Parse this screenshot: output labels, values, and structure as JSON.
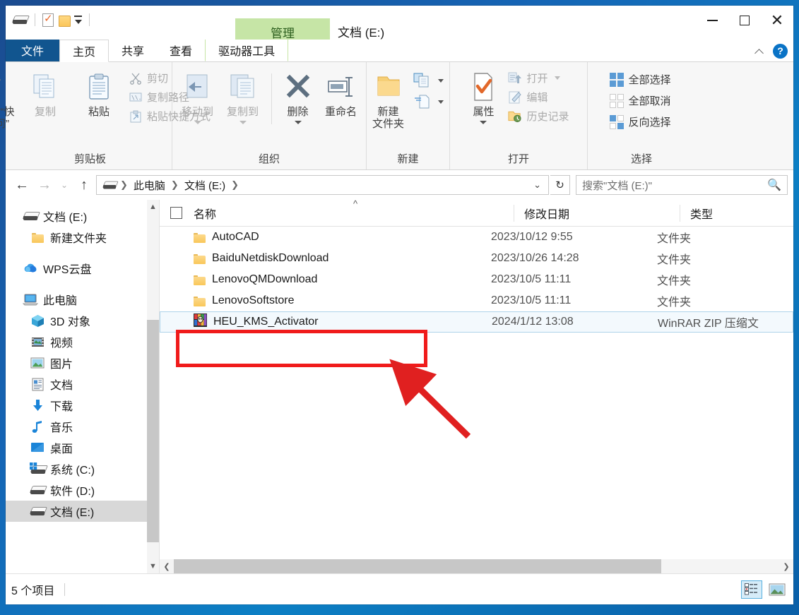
{
  "window": {
    "title": "文档 (E:)",
    "contextual_tab_header": "管理",
    "controls": {
      "minimize": "minimize-icon",
      "maximize": "maximize-icon",
      "close": "close-icon"
    }
  },
  "quick_access": {
    "items": [
      {
        "name": "drive-icon",
        "label": "文档 (E:)"
      },
      {
        "name": "properties-icon",
        "label": "属性"
      },
      {
        "name": "new-folder-icon",
        "label": "新建文件夹"
      },
      {
        "name": "customize-caret-icon",
        "label": "自定义快速访问工具栏"
      }
    ]
  },
  "tabs": [
    {
      "id": "file",
      "label": "文件",
      "state": "file"
    },
    {
      "id": "home",
      "label": "主页",
      "state": "active"
    },
    {
      "id": "share",
      "label": "共享",
      "state": "normal"
    },
    {
      "id": "view",
      "label": "查看",
      "state": "normal"
    },
    {
      "id": "drive-tools",
      "label": "驱动器工具",
      "state": "contextual"
    }
  ],
  "ribbon_right": {
    "collapse": "chevron-up-icon",
    "help": "?"
  },
  "ribbon": {
    "groups": [
      {
        "id": "clipboard",
        "label": "剪贴板",
        "big_buttons": [
          {
            "id": "pin-to-quick-access",
            "label": "固定到“快\n速访问”",
            "icon": "pin-icon",
            "dim": false
          },
          {
            "id": "copy",
            "label": "复制",
            "icon": "copy-icon",
            "dim": true
          },
          {
            "id": "paste",
            "label": "粘贴",
            "icon": "paste-icon",
            "dim": false
          }
        ],
        "small_buttons": [
          {
            "id": "cut",
            "label": "剪切",
            "icon": "scissors-icon",
            "dim": true
          },
          {
            "id": "copy-path",
            "label": "复制路径",
            "icon": "copy-path-icon",
            "dim": true
          },
          {
            "id": "paste-shortcut",
            "label": "粘贴快捷方式",
            "icon": "paste-shortcut-icon",
            "dim": true
          }
        ]
      },
      {
        "id": "organize",
        "label": "组织",
        "big_buttons": [
          {
            "id": "move-to",
            "label": "移动到",
            "icon": "move-to-icon",
            "dim": true,
            "caret": true
          },
          {
            "id": "copy-to",
            "label": "复制到",
            "icon": "copy-to-icon",
            "dim": true,
            "caret": true
          },
          {
            "id": "delete",
            "label": "删除",
            "icon": "delete-x-icon",
            "dim": false,
            "caret": true
          },
          {
            "id": "rename",
            "label": "重命名",
            "icon": "rename-icon",
            "dim": false,
            "caret": false
          }
        ]
      },
      {
        "id": "new",
        "label": "新建",
        "big_buttons": [
          {
            "id": "new-folder",
            "label": "新建\n文件夹",
            "icon": "new-folder-icon",
            "dim": false
          }
        ],
        "small_buttons": [
          {
            "id": "new-item",
            "label": "",
            "icon": "new-item-icon",
            "dim": false,
            "caret": true
          },
          {
            "id": "easy-access",
            "label": "",
            "icon": "easy-access-icon",
            "dim": false,
            "caret": true
          }
        ]
      },
      {
        "id": "open",
        "label": "打开",
        "big_buttons": [
          {
            "id": "properties",
            "label": "属性",
            "icon": "properties-icon",
            "dim": false,
            "caret": true
          }
        ],
        "small_buttons": [
          {
            "id": "open",
            "label": "打开",
            "icon": "open-icon",
            "dim": true,
            "caret": true
          },
          {
            "id": "edit",
            "label": "编辑",
            "icon": "edit-icon",
            "dim": true
          },
          {
            "id": "history",
            "label": "历史记录",
            "icon": "history-icon",
            "dim": true
          }
        ]
      },
      {
        "id": "select",
        "label": "选择",
        "small_buttons": [
          {
            "id": "select-all",
            "label": "全部选择",
            "icon": "select-all-icon",
            "dim": false
          },
          {
            "id": "select-none",
            "label": "全部取消",
            "icon": "select-none-icon",
            "dim": false
          },
          {
            "id": "invert-selection",
            "label": "反向选择",
            "icon": "invert-selection-icon",
            "dim": false
          }
        ]
      }
    ]
  },
  "navbar": {
    "back": "←",
    "forward": "→",
    "recent": "⌄",
    "up": "↑",
    "breadcrumbs": [
      {
        "label": "此电脑"
      },
      {
        "label": "文档 (E:)"
      }
    ],
    "refresh": "↻",
    "search_placeholder": "搜索\"文档 (E:)\""
  },
  "sidebar": {
    "items": [
      {
        "id": "doc-e-quick",
        "label": "文档 (E:)",
        "icon": "drive-icon",
        "indent": 1,
        "selected": false
      },
      {
        "id": "new-folder-quick",
        "label": "新建文件夹",
        "icon": "folder-icon",
        "indent": 1,
        "selected": false
      },
      {
        "id": "spacer-1",
        "label": "",
        "icon": "",
        "spacer": true
      },
      {
        "id": "wps-cloud",
        "label": "WPS云盘",
        "icon": "cloud-icon",
        "indent": 0,
        "selected": false
      },
      {
        "id": "spacer-2",
        "label": "",
        "icon": "",
        "spacer": true
      },
      {
        "id": "this-pc",
        "label": "此电脑",
        "icon": "computer-icon",
        "indent": 0,
        "selected": false
      },
      {
        "id": "3d-objects",
        "label": "3D 对象",
        "icon": "3d-objects-icon",
        "indent": 1,
        "selected": false
      },
      {
        "id": "videos",
        "label": "视频",
        "icon": "videos-icon",
        "indent": 1,
        "selected": false
      },
      {
        "id": "pictures",
        "label": "图片",
        "icon": "pictures-icon",
        "indent": 1,
        "selected": false
      },
      {
        "id": "documents",
        "label": "文档",
        "icon": "documents-icon",
        "indent": 1,
        "selected": false
      },
      {
        "id": "downloads",
        "label": "下载",
        "icon": "downloads-icon",
        "indent": 1,
        "selected": false
      },
      {
        "id": "music",
        "label": "音乐",
        "icon": "music-icon",
        "indent": 1,
        "selected": false
      },
      {
        "id": "desktop",
        "label": "桌面",
        "icon": "desktop-icon",
        "indent": 1,
        "selected": false
      },
      {
        "id": "drive-c",
        "label": "系统 (C:)",
        "icon": "windows-drive-icon",
        "indent": 1,
        "selected": false
      },
      {
        "id": "drive-d",
        "label": "软件 (D:)",
        "icon": "drive-icon",
        "indent": 1,
        "selected": false
      },
      {
        "id": "drive-e",
        "label": "文档 (E:)",
        "icon": "drive-icon",
        "indent": 1,
        "selected": true
      }
    ]
  },
  "file_list": {
    "columns": [
      {
        "id": "name",
        "label": "名称",
        "sorted": "asc"
      },
      {
        "id": "date",
        "label": "修改日期"
      },
      {
        "id": "type",
        "label": "类型"
      }
    ],
    "rows": [
      {
        "name": "AutoCAD",
        "date": "2023/10/12 9:55",
        "type": "文件夹",
        "icon": "folder-icon",
        "selected": false
      },
      {
        "name": "BaiduNetdiskDownload",
        "date": "2023/10/26 14:28",
        "type": "文件夹",
        "icon": "folder-icon",
        "selected": false
      },
      {
        "name": "LenovoQMDownload",
        "date": "2023/10/5 11:11",
        "type": "文件夹",
        "icon": "folder-icon",
        "selected": false
      },
      {
        "name": "LenovoSoftstore",
        "date": "2023/10/5 11:11",
        "type": "文件夹",
        "icon": "folder-icon",
        "selected": false
      },
      {
        "name": "HEU_KMS_Activator",
        "date": "2024/1/12 13:08",
        "type": "WinRAR ZIP 压缩文",
        "icon": "winrar-archive-icon",
        "selected": true
      }
    ]
  },
  "statusbar": {
    "item_count": "5 个项目",
    "view_buttons": [
      {
        "id": "details-view",
        "label": "详细信息",
        "icon": "details-view-icon",
        "active": true
      },
      {
        "id": "large-icons-view",
        "label": "大图标",
        "icon": "large-icons-view-icon",
        "active": false
      }
    ]
  },
  "annotations": {
    "highlight_rect": {
      "target": "HEU_KMS_Activator",
      "color": "#f01b1b"
    },
    "arrow": {
      "color": "#e02020",
      "points_to": "HEU_KMS_Activator"
    }
  },
  "colors": {
    "accent_blue": "#11558f",
    "contextual_green": "#c6e5a6",
    "annotation_red": "#f01b1b",
    "selection_blue": "#f3f9fd"
  }
}
